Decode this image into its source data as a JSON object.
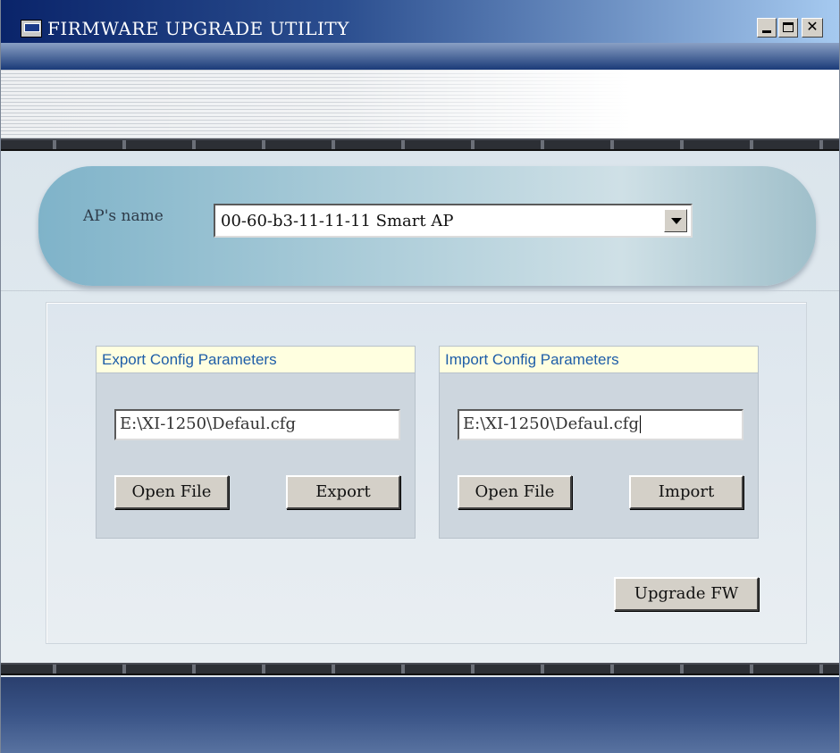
{
  "window": {
    "title": "FIRMWARE UPGRADE UTILITY"
  },
  "ap": {
    "label": "AP's name",
    "selected": "00-60-b3-11-11-11  Smart AP"
  },
  "export": {
    "header": "Export Config Parameters",
    "path": "E:\\XI-1250\\Defaul.cfg",
    "open_file_label": "Open File",
    "action_label": "Export"
  },
  "import": {
    "header": "Import Config Parameters",
    "path": "E:\\XI-1250\\Defaul.cfg",
    "open_file_label": "Open File",
    "action_label": "Import"
  },
  "upgrade": {
    "label": "Upgrade FW"
  },
  "icons": {
    "app": "app-window-icon",
    "minimize": "minimize-icon",
    "maximize": "maximize-icon",
    "close": "close-icon",
    "dropdown": "chevron-down-icon"
  },
  "colors": {
    "title_bar_start": "#0a246a",
    "title_bar_end": "#a6caf0",
    "group_header_bg": "#ffffe0",
    "group_header_text": "#1f5ea8",
    "button_face": "#d4d0c8"
  }
}
